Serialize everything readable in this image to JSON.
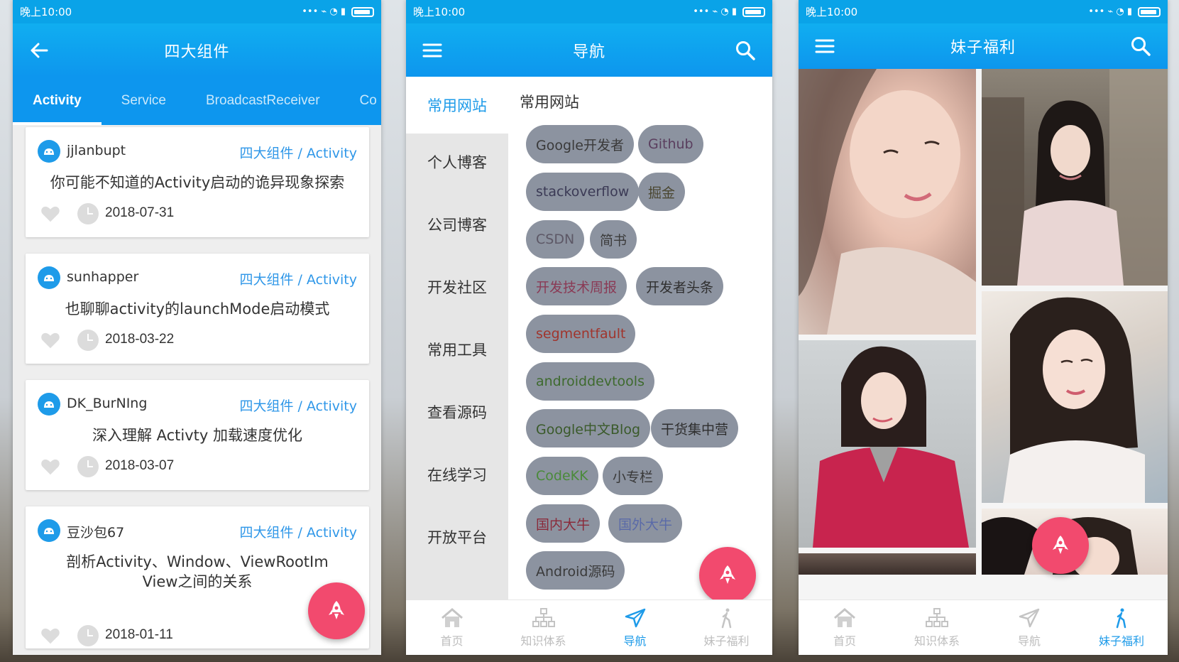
{
  "status": {
    "time": "晚上10:00",
    "icons": "... ⊘ ☰"
  },
  "phone1": {
    "title": "四大组件",
    "tabs": [
      "Activity",
      "Service",
      "BroadcastReceiver",
      "Co"
    ],
    "articles": [
      {
        "author": "jjlanbupt",
        "chapter": "四大组件 / Activity",
        "title": "你可能不知道的Activity启动的诡异现象探索",
        "title2": "",
        "date": "2018-07-31"
      },
      {
        "author": "sunhapper",
        "chapter": "四大组件 / Activity",
        "title": "也聊聊activity的launchMode启动模式",
        "title2": "",
        "date": "2018-03-22"
      },
      {
        "author": "DK_BurNIng",
        "chapter": "四大组件 / Activity",
        "title": "深入理解 Activty 加载速度优化",
        "title2": "",
        "date": "2018-03-07"
      },
      {
        "author": "豆沙包67",
        "chapter": "四大组件 / Activity",
        "title": "剖析Activity、Window、ViewRootIm",
        "title2": "View之间的关系",
        "date": "2018-01-11"
      }
    ]
  },
  "phone2": {
    "title": "导航",
    "nav_items": [
      "常用网站",
      "个人博客",
      "公司博客",
      "开发社区",
      "常用工具",
      "查看源码",
      "在线学习",
      "开放平台"
    ],
    "section_title": "常用网站",
    "chips": [
      {
        "label": "Google开发者",
        "color": "#3a3a3a"
      },
      {
        "label": "Github",
        "color": "#5a3e5e"
      },
      {
        "label": "stackoverflow",
        "color": "#3b3a55"
      },
      {
        "label": "掘金",
        "color": "#4a4630"
      },
      {
        "label": "CSDN",
        "color": "#5d5866"
      },
      {
        "label": "简书",
        "color": "#3c3c3c"
      },
      {
        "label": "开发技术周报",
        "color": "#8a3a55"
      },
      {
        "label": "开发者头条",
        "color": "#2f2f2f"
      },
      {
        "label": "segmentfault",
        "color": "#a0352d"
      },
      {
        "label": "androiddevtools",
        "color": "#3e6a2e"
      },
      {
        "label": "Google中文Blog",
        "color": "#3a5a2a"
      },
      {
        "label": "干货集中营",
        "color": "#2e2e2e"
      },
      {
        "label": "CodeKK",
        "color": "#4a8a3a"
      },
      {
        "label": "小专栏",
        "color": "#3a3a3a"
      },
      {
        "label": "国内大牛",
        "color": "#8a2a3a"
      },
      {
        "label": "国外大牛",
        "color": "#5a6aa8"
      },
      {
        "label": "Android源码",
        "color": "#3a3a3a"
      }
    ]
  },
  "phone3": {
    "title": "妹子福利"
  },
  "bottom_nav": [
    "首页",
    "知识体系",
    "导航",
    "妹子福利"
  ],
  "colors": {
    "primary": "#0d96ee",
    "accent": "#f24a6e",
    "active_text": "#1e9be9",
    "chip_bg": "#8c93a0"
  }
}
